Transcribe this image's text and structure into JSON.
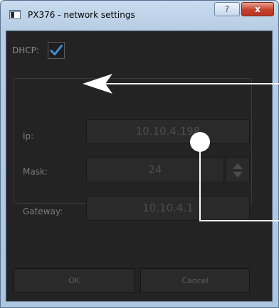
{
  "window": {
    "title": "PX376 - network settings",
    "help_label": "?",
    "close_label": "x"
  },
  "dhcp": {
    "label": "DHCP:",
    "checked": true
  },
  "fields": {
    "ip": {
      "label": "Ip:",
      "value": "10.10.4.198"
    },
    "mask": {
      "label": "Mask:",
      "value": "24"
    },
    "gateway": {
      "label": "Gateway:",
      "value": "10.10.4.1"
    }
  },
  "buttons": {
    "ok": "OK",
    "cancel": "Cancel"
  },
  "colors": {
    "accent": "#3d8fd9",
    "background": "#232323",
    "frame": "#b7cde4",
    "annotation": "#ffffff"
  },
  "icons": {
    "app": "window-icon",
    "help": "question-icon",
    "close": "close-icon",
    "check": "checkmark-icon",
    "spin_up": "chevron-up-icon",
    "spin_down": "chevron-down-icon"
  }
}
